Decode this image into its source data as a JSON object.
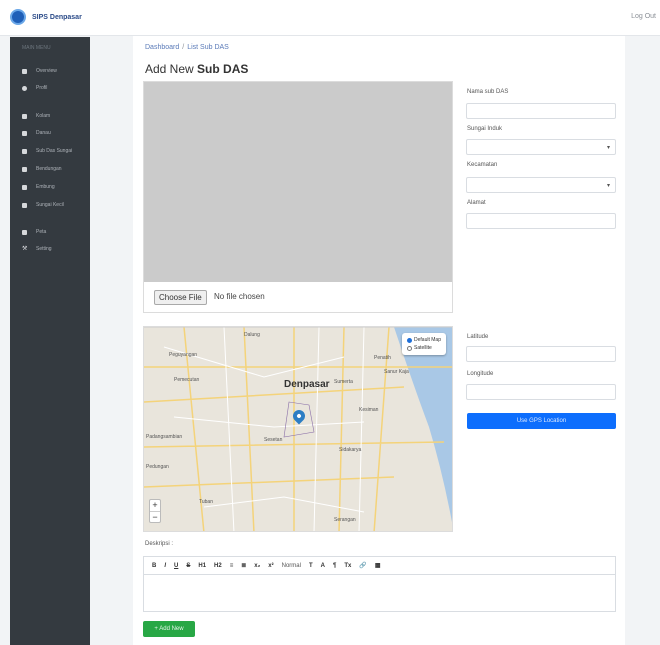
{
  "app": {
    "brand": "SIPS Denpasar",
    "logout": "Log Out"
  },
  "sidebar": {
    "header": "MAIN MENU",
    "items": [
      {
        "label": "Overview",
        "icon": "home-icon"
      },
      {
        "label": "Profil",
        "icon": "circle-icon"
      },
      {
        "label": "Kolam",
        "icon": "square-icon"
      },
      {
        "label": "Danau",
        "icon": "square-icon"
      },
      {
        "label": "Sub Das Sungai",
        "icon": "square-icon"
      },
      {
        "label": "Bendungan",
        "icon": "square-icon"
      },
      {
        "label": "Embung",
        "icon": "square-icon"
      },
      {
        "label": "Sungai Kecil",
        "icon": "square-icon"
      },
      {
        "label": "Peta",
        "icon": "map-icon"
      },
      {
        "label": "Setting",
        "icon": "wrench-icon"
      }
    ]
  },
  "breadcrumb": {
    "home": "Dashboard",
    "current": "List Sub DAS"
  },
  "page": {
    "title_prefix": "Add New",
    "title_bold": "Sub DAS"
  },
  "upload": {
    "button": "Choose File",
    "status": "No file chosen"
  },
  "form": {
    "name_label": "Nama sub DAS",
    "river_label": "Sungai Induk",
    "district_label": "Kecamatan",
    "address_label": "Alamat",
    "lat_label": "Latitude",
    "lng_label": "Longitude",
    "gps_button": "Use GPS Location"
  },
  "map": {
    "city": "Denpasar",
    "layers": [
      "Default Map",
      "Satellite"
    ],
    "labels": [
      "Dalung",
      "Penatih",
      "Peguyangan",
      "Sumerta",
      "Sanur Kaja",
      "Kesiman",
      "Padangsambian",
      "Pemecutan",
      "Sidakarya",
      "Sesetan",
      "Pedungan",
      "Serangan",
      "Tuban"
    ],
    "zoom_in": "+",
    "zoom_out": "−",
    "accent": "#2d7ec4"
  },
  "description": {
    "label": "Deskripsi :",
    "toolbar": [
      "B",
      "I",
      "U",
      "S",
      "H1",
      "H2",
      "≡",
      "≣",
      "x₂",
      "x²",
      "Normal",
      "T",
      "A",
      "¶",
      "Tx",
      "🔗",
      "▦"
    ]
  },
  "actions": {
    "add": "+ Add New"
  },
  "colors": {
    "sidebar": "#343a40",
    "primary": "#0d6efd",
    "success": "#28a745"
  }
}
